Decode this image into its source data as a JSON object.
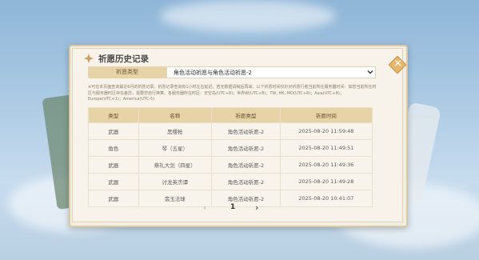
{
  "header": {
    "title": "祈愿历史记录",
    "close_glyph": "✕"
  },
  "filter": {
    "label": "祈愿类型",
    "selected": "角色活动祈愿与角色活动祈愿-2"
  },
  "notice": "※可在本页面查询最近6月的祈愿记录。祈愿记录查询有1小时左右延迟，若无数据请稍后再来。以下祈愿时间仅针对祈愿行者当前所在服务器时间：如您当前所在时区与服务器时区存在差异，需要您自行换算。各服务器所在时区：天空岛(UTC+8)；世界树(UTC+8)；TW, HK, MO(UTC+8)；Asia(UTC+8)；Europe(UTC+1)；America(UTC-5)",
  "table": {
    "headers": [
      "类型",
      "名称",
      "祈愿类型",
      "祈愿时间"
    ],
    "rows": [
      {
        "type": "武器",
        "name": "黑缨枪",
        "banner": "角色活动祈愿-2",
        "time": "2025-08-20 11:59:48",
        "rarity": "3"
      },
      {
        "type": "角色",
        "name": "琴（五星）",
        "banner": "角色活动祈愿-2",
        "time": "2025-08-20 11:49:51",
        "rarity": "5"
      },
      {
        "type": "武器",
        "name": "祭礼大剑（四星）",
        "banner": "角色活动祈愿-2",
        "time": "2025-08-20 11:49:36",
        "rarity": "4"
      },
      {
        "type": "武器",
        "name": "讨龙英杰谭",
        "banner": "角色活动祈愿-2",
        "time": "2025-08-20 11:49:28",
        "rarity": "3"
      },
      {
        "type": "武器",
        "name": "翡玉法球",
        "banner": "角色活动祈愿-2",
        "time": "2025-08-20 10:41:07",
        "rarity": "3"
      }
    ]
  },
  "pager": {
    "prev": "‹",
    "page": "1",
    "next": "›"
  },
  "colors": {
    "header_bg": "#e6d3a6",
    "five_star": "#b36f2e",
    "four_star": "#8a4fb6"
  }
}
